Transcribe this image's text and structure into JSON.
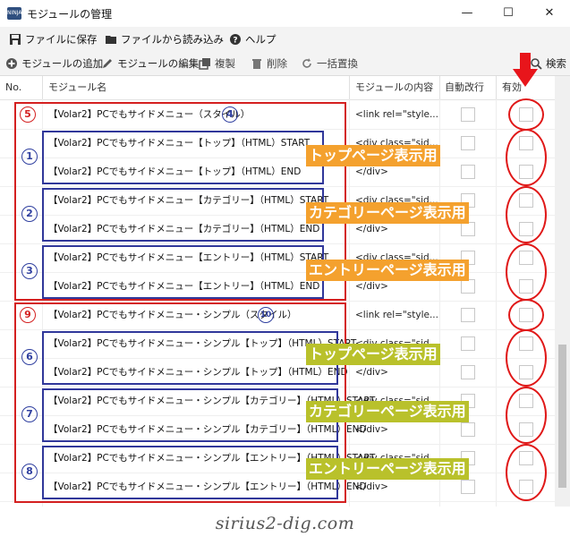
{
  "window": {
    "title": "モジュールの管理",
    "app_icon_text": "NINJA",
    "minimize": "—",
    "maximize": "☐",
    "close": "✕"
  },
  "menu": {
    "save": "ファイルに保存",
    "load": "ファイルから読み込み",
    "help": "ヘルプ"
  },
  "toolbar": {
    "add": "モジュールの追加",
    "edit": "モジュールの編集",
    "copy": "複製",
    "delete": "削除",
    "replace": "一括置換",
    "search": "検索"
  },
  "columns": {
    "no": "No.",
    "name": "モジュール名",
    "content": "モジュールの内容",
    "autobreak": "自動改行",
    "enabled": "有効"
  },
  "rows": [
    {
      "name": "【Volar2】PCでもサイドメニュー（スタイル）",
      "content": "<link rel=\"style..."
    },
    {
      "name": "【Volar2】PCでもサイドメニュー【トップ】（HTML）START",
      "content": "<div class=\"sid..."
    },
    {
      "name": "【Volar2】PCでもサイドメニュー【トップ】（HTML）END",
      "content": "</div>"
    },
    {
      "name": "【Volar2】PCでもサイドメニュー【カテゴリー】（HTML）START",
      "content": "<div class=\"sid..."
    },
    {
      "name": "【Volar2】PCでもサイドメニュー【カテゴリー】（HTML）END",
      "content": "</div>"
    },
    {
      "name": "【Volar2】PCでもサイドメニュー【エントリー】（HTML）START",
      "content": "<div class=\"sid..."
    },
    {
      "name": "【Volar2】PCでもサイドメニュー【エントリー】（HTML）END",
      "content": "</div>"
    },
    {
      "name": "【Volar2】PCでもサイドメニュー・シンプル（スタイル）",
      "content": "<link rel=\"style..."
    },
    {
      "name": "【Volar2】PCでもサイドメニュー・シンプル【トップ】（HTML）START",
      "content": "<div class=\"sid..."
    },
    {
      "name": "【Volar2】PCでもサイドメニュー・シンプル【トップ】（HTML）END",
      "content": "</div>"
    },
    {
      "name": "【Volar2】PCでもサイドメニュー・シンプル【カテゴリー】（HTML）START",
      "content": "<div class=\"sid..."
    },
    {
      "name": "【Volar2】PCでもサイドメニュー・シンプル【カテゴリー】（HTML）END",
      "content": "</div>"
    },
    {
      "name": "【Volar2】PCでもサイドメニュー・シンプル【エントリー】（HTML）START",
      "content": "<div class=\"sid..."
    },
    {
      "name": "【Volar2】PCでもサイドメニュー・シンプル【エントリー】（HTML）END",
      "content": "</div>"
    }
  ],
  "annotations": {
    "markers": [
      "5",
      "4",
      "1",
      "2",
      "3",
      "9",
      "10",
      "6",
      "7",
      "8"
    ],
    "labels": {
      "top": "トップページ表示用",
      "category": "カテゴリーページ表示用",
      "entry": "エントリーページ表示用"
    },
    "colors": {
      "red": "#d42020",
      "blue": "#30379a",
      "orange": "#f4a12e",
      "olive": "#b9c12b"
    }
  },
  "watermark": "sirius2-dig.com"
}
